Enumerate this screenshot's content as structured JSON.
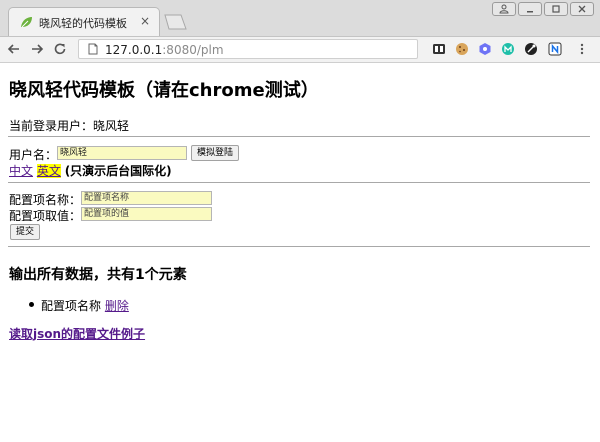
{
  "browser": {
    "tab_title": "晓风轻的代码模板",
    "tab_close": "×",
    "url_host": "127.0.0.1",
    "url_rest": ":8080/plm"
  },
  "page": {
    "title": "晓风轻代码模板（请在chrome测试）",
    "current_user_label": "当前登录用户：",
    "current_user_name": "晓风轻",
    "login": {
      "username_label": "用户名：",
      "username_value": "晓风轻",
      "login_button": "模拟登陆"
    },
    "lang": {
      "chinese_link": "中文",
      "english_link": "英文",
      "note": "(只演示后台国际化)"
    },
    "config_form": {
      "name_label": "配置项名称：",
      "name_placeholder": "配置项名称",
      "value_label": "配置项取值：",
      "value_placeholder": "配置项的值",
      "submit_button": "提交"
    },
    "output": {
      "heading": "输出所有数据，共有1个元素",
      "items": [
        {
          "name": "配置项名称",
          "delete_link": "删除"
        }
      ]
    },
    "json_example_link": "读取json的配置文件例子"
  }
}
